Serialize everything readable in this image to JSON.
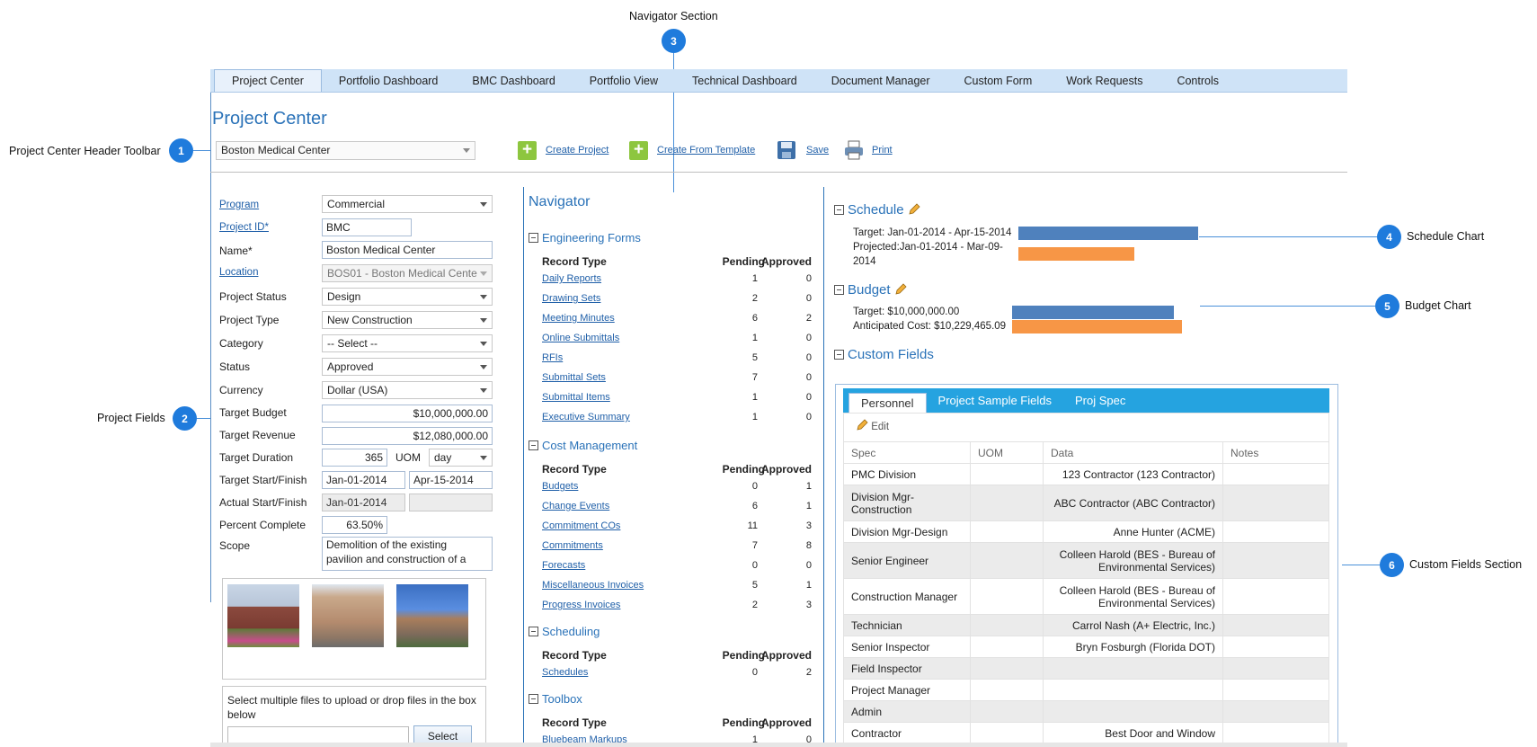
{
  "callouts": {
    "navigator_section": "Navigator Section",
    "header_toolbar": "Project Center Header Toolbar",
    "project_fields": "Project Fields",
    "schedule_chart": "Schedule Chart",
    "budget_chart": "Budget Chart",
    "custom_fields_section": "Custom Fields Section",
    "n1": "1",
    "n2": "2",
    "n3": "3",
    "n4": "4",
    "n5": "5",
    "n6": "6"
  },
  "tabs": [
    "Project Center",
    "Portfolio Dashboard",
    "BMC Dashboard",
    "Portfolio View",
    "Technical Dashboard",
    "Document Manager",
    "Custom Form",
    "Work Requests",
    "Controls"
  ],
  "page_title": "Project Center",
  "toolbar": {
    "project_select": "Boston Medical Center",
    "create_project": "Create Project",
    "create_from_template": "Create From Template",
    "save": "Save",
    "print": "Print"
  },
  "fields": {
    "program_label": "Program",
    "program": "Commercial",
    "project_id_label": "Project ID*",
    "project_id": "BMC",
    "name_label": "Name*",
    "name": "Boston Medical Center",
    "location_label": "Location",
    "location": "BOS01 - Boston Medical Cente",
    "project_status_label": "Project Status",
    "project_status": "Design",
    "project_type_label": "Project Type",
    "project_type": "New Construction",
    "category_label": "Category",
    "category": "-- Select --",
    "status_label": "Status",
    "status": "Approved",
    "currency_label": "Currency",
    "currency": "Dollar (USA)",
    "target_budget_label": "Target Budget",
    "target_budget": "$10,000,000.00",
    "target_revenue_label": "Target Revenue",
    "target_revenue": "$12,080,000.00",
    "target_duration_label": "Target Duration",
    "target_duration": "365",
    "uom_label": "UOM",
    "uom": "day",
    "target_start_finish_label": "Target Start/Finish",
    "target_start": "Jan-01-2014",
    "target_finish": "Apr-15-2014",
    "actual_start_finish_label": "Actual Start/Finish",
    "actual_start": "Jan-01-2014",
    "actual_finish": "",
    "percent_complete_label": "Percent Complete",
    "percent_complete": "63.50%",
    "scope_label": "Scope",
    "scope": "Demolition of the existing pavilion and construction of a",
    "upload_text": "Select multiple files to upload or drop files in the box below",
    "select_button": "Select"
  },
  "navigator": {
    "title": "Navigator",
    "col_record": "Record Type",
    "col_pending": "Pending",
    "col_approved": "Approved",
    "sections": [
      {
        "name": "Engineering Forms",
        "rows": [
          [
            "Daily Reports",
            "1",
            "0"
          ],
          [
            "Drawing Sets",
            "2",
            "0"
          ],
          [
            "Meeting Minutes",
            "6",
            "2"
          ],
          [
            "Online Submittals",
            "1",
            "0"
          ],
          [
            "RFIs",
            "5",
            "0"
          ],
          [
            "Submittal Sets",
            "7",
            "0"
          ],
          [
            "Submittal Items",
            "1",
            "0"
          ],
          [
            "Executive Summary",
            "1",
            "0"
          ]
        ]
      },
      {
        "name": "Cost Management",
        "rows": [
          [
            "Budgets",
            "0",
            "1"
          ],
          [
            "Change Events",
            "6",
            "1"
          ],
          [
            "Commitment COs",
            "11",
            "3"
          ],
          [
            "Commitments",
            "7",
            "8"
          ],
          [
            "Forecasts",
            "0",
            "0"
          ],
          [
            "Miscellaneous Invoices",
            "5",
            "1"
          ],
          [
            "Progress Invoices",
            "2",
            "3"
          ]
        ]
      },
      {
        "name": "Scheduling",
        "rows": [
          [
            "Schedules",
            "0",
            "2"
          ]
        ]
      },
      {
        "name": "Toolbox",
        "rows": [
          [
            "Bluebeam Markups",
            "1",
            "0"
          ]
        ]
      }
    ]
  },
  "schedule": {
    "title": "Schedule",
    "target_label": "Target: Jan-01-2014 - Apr-15-2014",
    "projected_label_1": "Projected:Jan-01-2014 - Mar-09-",
    "projected_label_2": "2014",
    "colors": {
      "target": "#4f81bd",
      "projected": "#f79646"
    }
  },
  "budget": {
    "title": "Budget",
    "target_label": "Target: $10,000,000.00",
    "anticipated_label": "Anticipated Cost: $10,229,465.09",
    "target_value": 10000000,
    "anticipated_value": 10229465.09
  },
  "custom_fields": {
    "title": "Custom Fields",
    "tabs": [
      "Personnel",
      "Project Sample Fields",
      "Proj Spec"
    ],
    "edit": "Edit",
    "columns": [
      "Spec",
      "UOM",
      "Data",
      "Notes"
    ],
    "rows": [
      [
        "PMC Division",
        "",
        "123 Contractor (123 Contractor)",
        ""
      ],
      [
        "Division Mgr-Construction",
        "",
        "ABC Contractor (ABC Contractor)",
        ""
      ],
      [
        "Division Mgr-Design",
        "",
        "Anne Hunter (ACME)",
        ""
      ],
      [
        "Senior Engineer",
        "",
        "Colleen Harold (BES - Bureau of Environmental Services)",
        ""
      ],
      [
        "Construction Manager",
        "",
        "Colleen Harold (BES - Bureau of Environmental Services)",
        ""
      ],
      [
        "Technician",
        "",
        "Carrol Nash (A+ Electric, Inc.)",
        ""
      ],
      [
        "Senior Inspector",
        "",
        "Bryn Fosburgh (Florida DOT)",
        ""
      ],
      [
        "Field Inspector",
        "",
        "",
        ""
      ],
      [
        "Project Manager",
        "",
        "",
        ""
      ],
      [
        "Admin",
        "",
        "",
        ""
      ],
      [
        "Contractor",
        "",
        "Best Door and Window",
        ""
      ]
    ]
  }
}
